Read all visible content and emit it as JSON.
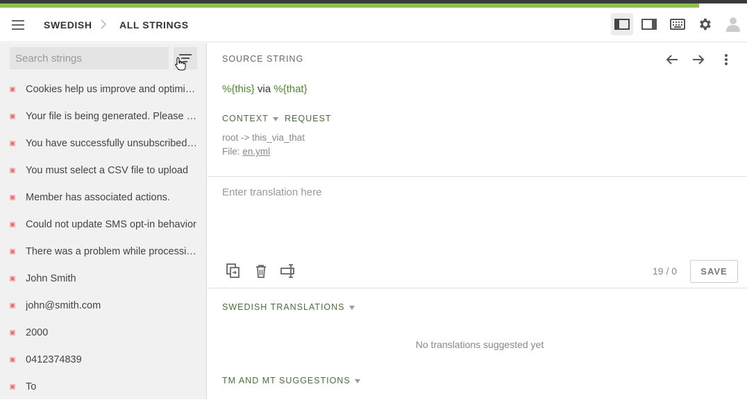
{
  "progress": {
    "fraction": 0.936
  },
  "header": {
    "breadcrumb": [
      "SWEDISH",
      "ALL STRINGS"
    ],
    "icons": [
      "sidebar-layout-icon",
      "panel-layout-icon",
      "keyboard-icon",
      "gear-icon",
      "user-icon"
    ]
  },
  "sidebar": {
    "search_placeholder": "Search strings",
    "items": [
      {
        "label": "Cookies help us improve and optimise our site"
      },
      {
        "label": "Your file is being generated. Please check your email"
      },
      {
        "label": "You have successfully unsubscribed from"
      },
      {
        "label": "You must select a CSV file to upload"
      },
      {
        "label": "Member has associated actions."
      },
      {
        "label": "Could not update SMS opt-in behavior"
      },
      {
        "label": "There was a problem while processing your request"
      },
      {
        "label": "John Smith"
      },
      {
        "label": "john@smith.com"
      },
      {
        "label": "2000"
      },
      {
        "label": "0412374839"
      },
      {
        "label": "To"
      }
    ]
  },
  "editor": {
    "source_label": "SOURCE STRING",
    "source": {
      "ph1": "%{this}",
      "mid": " via ",
      "ph2": "%{that}"
    },
    "tabs": {
      "context": "CONTEXT",
      "request": "REQUEST"
    },
    "context_key": "root -> this_via_that",
    "file_label": "File: ",
    "file_name": "en.yml",
    "translation_placeholder": "Enter translation here",
    "counter": "19 / 0",
    "save_label": "SAVE"
  },
  "translations": {
    "title": "SWEDISH TRANSLATIONS",
    "empty": "No translations suggested yet"
  },
  "tm": {
    "title": "TM AND MT SUGGESTIONS"
  },
  "colors": {
    "accent": "#8bc34a",
    "placeholder_green": "#4b8a2a",
    "dot": "#e26d6d"
  }
}
